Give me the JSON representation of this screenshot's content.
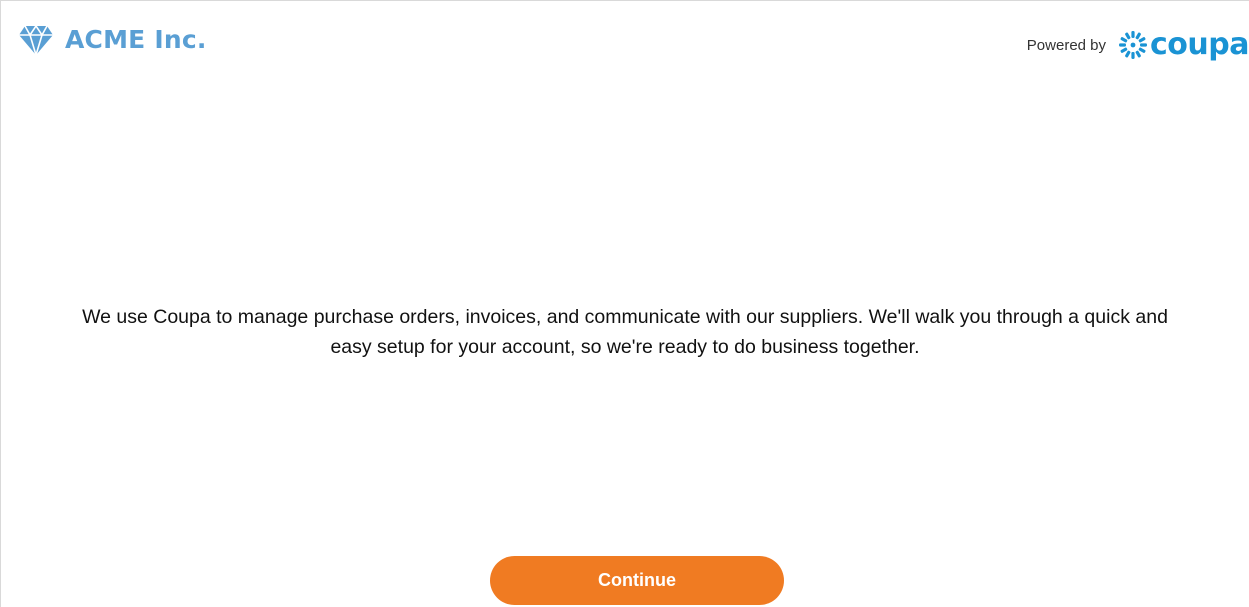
{
  "header": {
    "brand_name": "ACME Inc.",
    "brand_icon": "diamond-icon",
    "powered_by_label": "Powered by",
    "coupa_wordmark": "coupa",
    "coupa_icon": "coupa-burst-icon"
  },
  "main": {
    "message": "We use Coupa to manage purchase orders, invoices, and communicate with our suppliers. We'll walk you through a quick and easy setup for your account, so we're ready to do business together."
  },
  "footer": {
    "continue_label": "Continue"
  },
  "colors": {
    "brand_blue": "#5a9fd4",
    "coupa_blue": "#1a93d4",
    "button_orange": "#f07b22"
  }
}
